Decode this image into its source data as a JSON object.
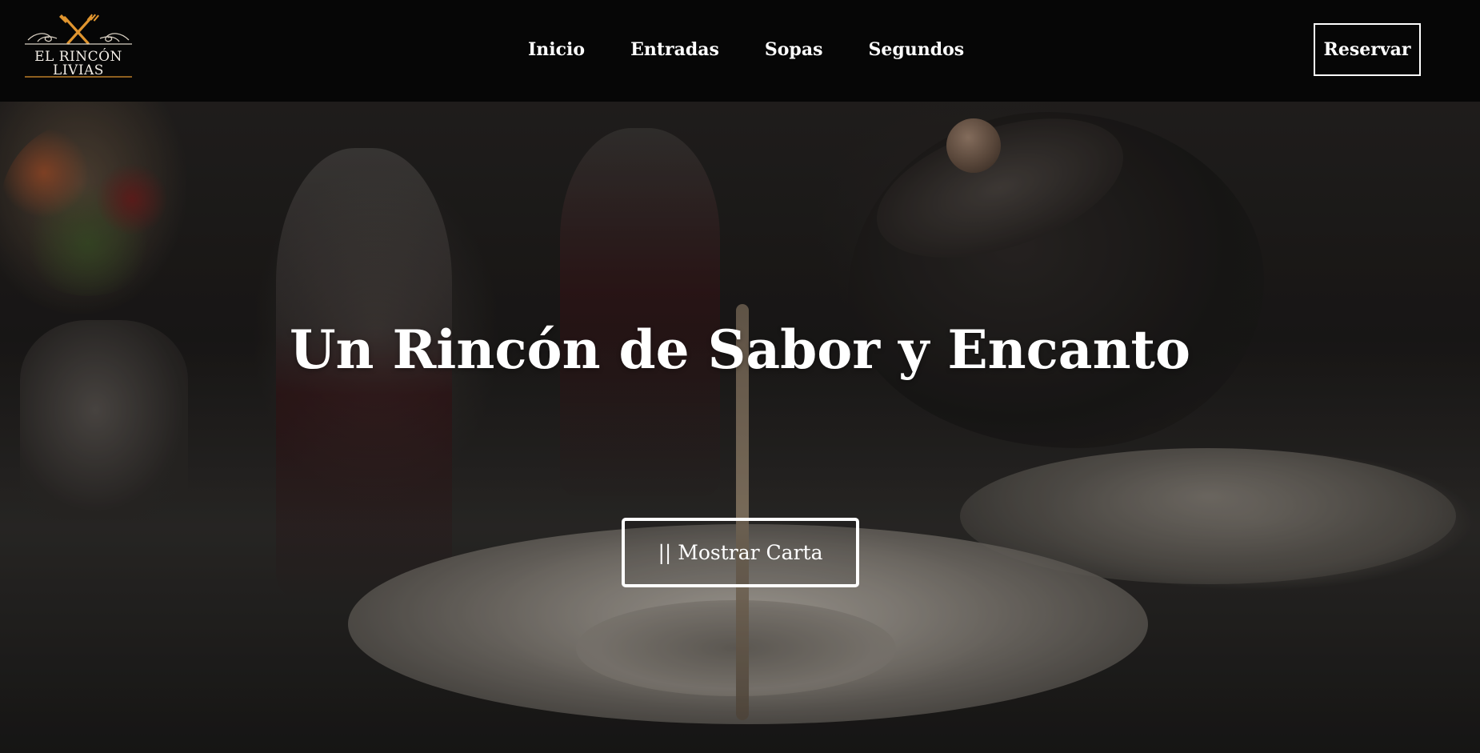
{
  "brand": {
    "line1": "EL RINCÓN",
    "line2": "LIVIAS",
    "accent_color": "#e0952f",
    "icon": "crossed-fork-knife-icon"
  },
  "nav": {
    "links": [
      {
        "label": "Inicio"
      },
      {
        "label": "Entradas"
      },
      {
        "label": "Sopas"
      },
      {
        "label": "Segundos"
      }
    ],
    "reserve_label": "Reservar"
  },
  "hero": {
    "title": "Un Rincón de Sabor y Encanto",
    "menu_button_label": "|| Mostrar Carta",
    "background": "restaurant-table-soup-pouring-photo"
  },
  "colors": {
    "navbar_bg": "#060606",
    "text": "#ffffff"
  }
}
